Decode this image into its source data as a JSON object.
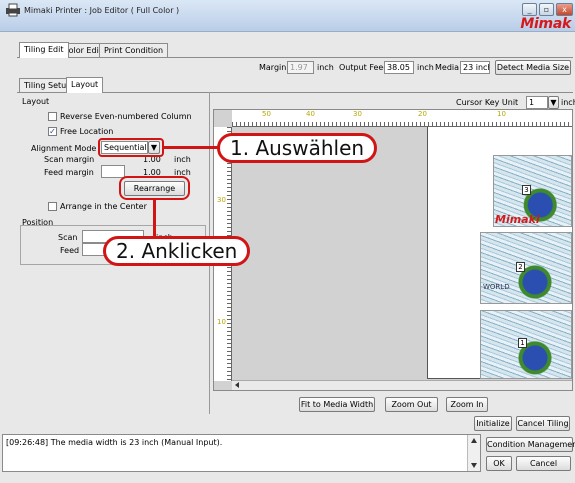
{
  "window": {
    "title": "Mimaki Printer : Job Editor ( Full Color )",
    "brand": "Mimak",
    "min_label": "_",
    "max_label": "▫",
    "close_label": "x"
  },
  "tabs": [
    {
      "label": "Tiling Edit"
    },
    {
      "label": "Color Edit"
    },
    {
      "label": "Print Condition"
    }
  ],
  "sub_tabs": [
    {
      "label": "Tiling Setup"
    },
    {
      "label": "Layout"
    }
  ],
  "media_bar": {
    "margin_label": "Margin",
    "margin_value": "1.97",
    "margin_unit": "inch",
    "output_feed_label": "Output Feed",
    "output_feed_value": "38.05",
    "output_feed_unit": "inch",
    "media_scan_label": "Media Scan",
    "media_scan_value": "23 inch",
    "detect_button": "Detect Media Size"
  },
  "layout_group": {
    "title": "Layout",
    "reverse_label": "Reverse Even-numbered Column",
    "reverse_checked": false,
    "free_location_label": "Free Location",
    "free_location_checked": true,
    "alignment_mode_label": "Alignment Mode",
    "alignment_mode_value": "Sequential",
    "scan_margin_label": "Scan margin",
    "scan_margin_value": "1.00",
    "scan_margin_unit": "inch",
    "feed_margin_label": "Feed margin",
    "feed_margin_value": "1.00",
    "feed_margin_unit": "inch",
    "rearrange_button": "Rearrange",
    "arrange_center_label": "Arrange in the Center",
    "arrange_center_checked": false
  },
  "position_group": {
    "title": "Position",
    "scan_label": "Scan",
    "scan_unit": "inch",
    "feed_label": "Feed"
  },
  "preview": {
    "cursor_key_unit_label": "Cursor Key Unit",
    "cursor_key_unit_value": "1",
    "cursor_key_unit_suffix": "inch",
    "ruler_h": [
      "50",
      "40",
      "30",
      "20",
      "10"
    ],
    "ruler_v": [
      "30",
      "10"
    ],
    "tiles": [
      {
        "num": "3"
      },
      {
        "num": "2"
      },
      {
        "num": "1"
      }
    ],
    "tile_caption": "Mimaki",
    "tile_caption_2": "WORLD"
  },
  "zoom_bar": {
    "fit_button": "Fit to Media Width",
    "zoom_out_button": "Zoom Out",
    "zoom_in_button": "Zoom In"
  },
  "actions": {
    "initialize_button": "Initialize",
    "cancel_tiling_button": "Cancel Tiling",
    "condition_management_button": "Condition Management",
    "ok_button": "OK",
    "cancel_button": "Cancel"
  },
  "log": {
    "message": "[09:26:48] The media width is 23 inch (Manual Input)."
  },
  "callouts": {
    "step1": "1. Auswählen",
    "step2": "2. Anklicken"
  },
  "colors": {
    "callout": "#d11414",
    "brand": "#d41a1a"
  }
}
